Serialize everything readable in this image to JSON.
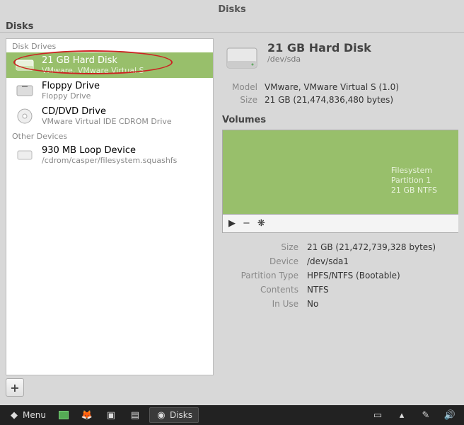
{
  "window_title": "Disks",
  "app_title": "Disks",
  "sidebar": {
    "sections": [
      {
        "label": "Disk Drives"
      },
      {
        "label": "Other Devices"
      }
    ],
    "disk_drives": [
      {
        "title": "21 GB Hard Disk",
        "sub": "VMware, VMware Virtual S",
        "selected": true
      },
      {
        "title": "Floppy Drive",
        "sub": "Floppy Drive"
      },
      {
        "title": "CD/DVD Drive",
        "sub": "VMware Virtual IDE CDROM Drive"
      }
    ],
    "other_devices": [
      {
        "title": "930 MB Loop Device",
        "sub": "/cdrom/casper/filesystem.squashfs"
      }
    ],
    "add_btn": "+"
  },
  "disk": {
    "title": "21 GB Hard Disk",
    "path": "/dev/sda",
    "model_label": "Model",
    "model": "VMware, VMware Virtual S (1.0)",
    "size_label": "Size",
    "size": "21 GB (21,474,836,480 bytes)"
  },
  "volumes": {
    "section": "Volumes",
    "partition_line1": "Filesystem",
    "partition_line2": "Partition 1",
    "partition_line3": "21 GB NTFS",
    "play": "▶",
    "minus": "−",
    "gear": "❋"
  },
  "details": {
    "size_label": "Size",
    "size": "21 GB (21,472,739,328 bytes)",
    "device_label": "Device",
    "device": "/dev/sda1",
    "ptype_label": "Partition Type",
    "ptype": "HPFS/NTFS (Bootable)",
    "contents_label": "Contents",
    "contents": "NTFS",
    "inuse_label": "In Use",
    "inuse": "No"
  },
  "taskbar": {
    "menu": "Menu",
    "task": "Disks"
  }
}
